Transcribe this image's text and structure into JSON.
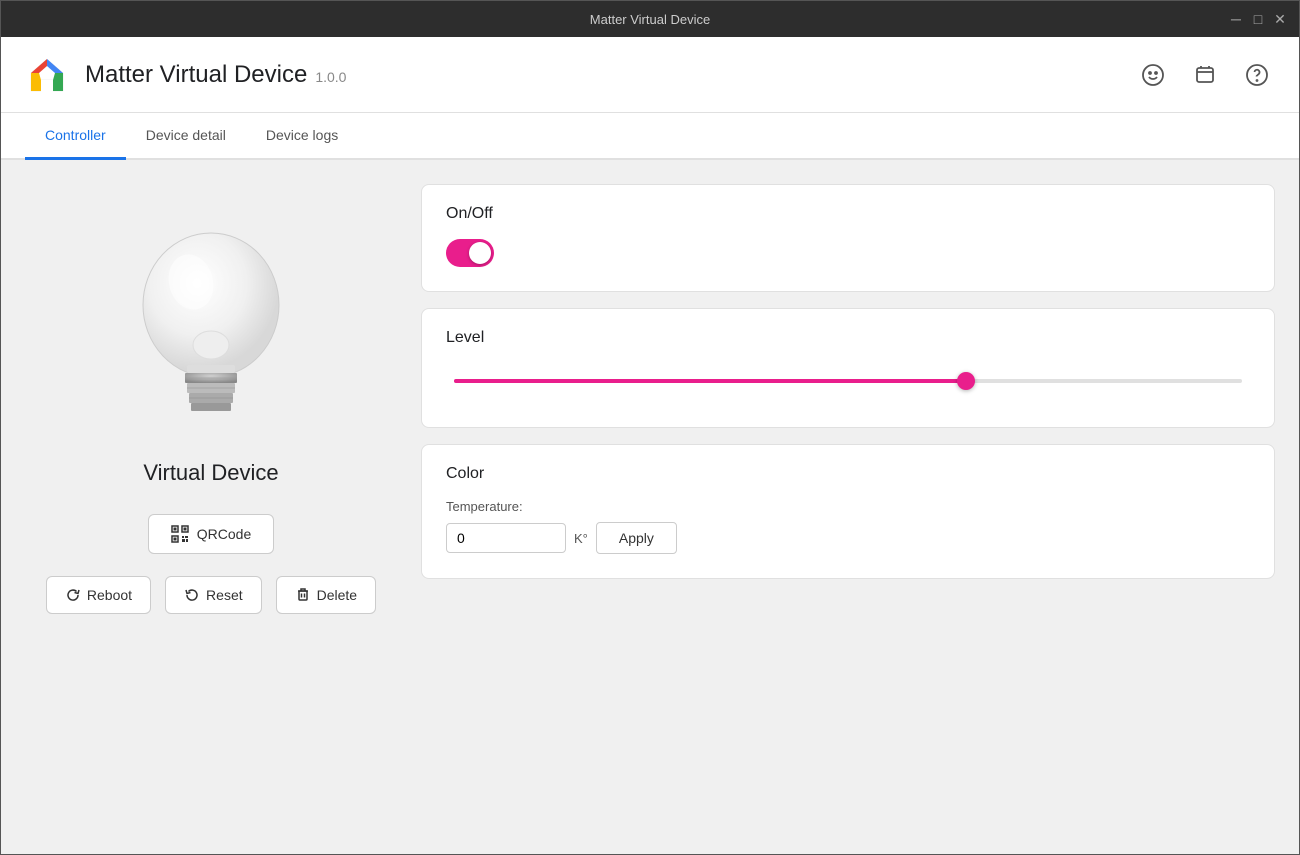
{
  "titlebar": {
    "title": "Matter Virtual Device",
    "min_btn": "─",
    "max_btn": "□",
    "close_btn": "✕"
  },
  "header": {
    "app_title": "Matter Virtual Device",
    "app_version": "1.0.0",
    "icon_smiley": "☺",
    "icon_feedback": "⊡",
    "icon_help": "?"
  },
  "tabs": [
    {
      "id": "controller",
      "label": "Controller",
      "active": true
    },
    {
      "id": "device-detail",
      "label": "Device detail",
      "active": false
    },
    {
      "id": "device-logs",
      "label": "Device logs",
      "active": false
    }
  ],
  "left_panel": {
    "device_name": "Virtual Device",
    "qrcode_btn": "QRCode",
    "reboot_btn": "Reboot",
    "reset_btn": "Reset",
    "delete_btn": "Delete"
  },
  "cards": {
    "onoff": {
      "title": "On/Off",
      "state": true
    },
    "level": {
      "title": "Level",
      "value": 65
    },
    "color": {
      "title": "Color",
      "temp_label": "Temperature:",
      "temp_value": "0",
      "temp_unit": "K°",
      "apply_label": "Apply"
    }
  }
}
